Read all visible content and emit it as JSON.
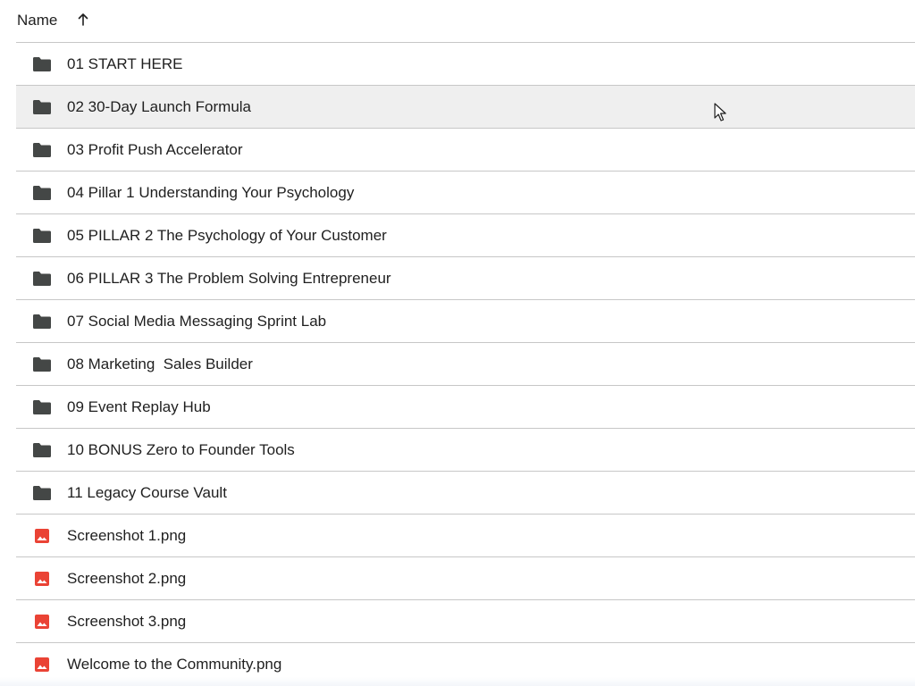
{
  "header": {
    "name_label": "Name",
    "sort_icon": "arrow-up-icon"
  },
  "rows": [
    {
      "label": "01 START HERE",
      "type": "folder",
      "icon": "folder-icon"
    },
    {
      "label": "02 30-Day Launch Formula",
      "type": "folder",
      "icon": "folder-icon",
      "hovered": true
    },
    {
      "label": "03 Profit Push Accelerator",
      "type": "folder",
      "icon": "folder-icon"
    },
    {
      "label": "04 Pillar 1 Understanding Your Psychology",
      "type": "folder",
      "icon": "folder-icon"
    },
    {
      "label": "05 PILLAR 2 The Psychology of Your Customer",
      "type": "folder",
      "icon": "folder-icon"
    },
    {
      "label": "06 PILLAR 3 The Problem Solving Entrepreneur",
      "type": "folder",
      "icon": "folder-icon"
    },
    {
      "label": "07 Social Media Messaging Sprint Lab",
      "type": "folder",
      "icon": "folder-icon"
    },
    {
      "label": "08 Marketing  Sales Builder",
      "type": "folder",
      "icon": "folder-icon"
    },
    {
      "label": "09 Event Replay Hub",
      "type": "folder",
      "icon": "folder-icon"
    },
    {
      "label": "10 BONUS Zero to Founder Tools",
      "type": "folder",
      "icon": "folder-icon"
    },
    {
      "label": "11 Legacy Course Vault",
      "type": "folder",
      "icon": "folder-icon"
    },
    {
      "label": "Screenshot 1.png",
      "type": "image",
      "icon": "image-file-icon"
    },
    {
      "label": "Screenshot 2.png",
      "type": "image",
      "icon": "image-file-icon"
    },
    {
      "label": "Screenshot 3.png",
      "type": "image",
      "icon": "image-file-icon"
    },
    {
      "label": "Welcome to the Community.png",
      "type": "image",
      "icon": "image-file-icon"
    }
  ],
  "colors": {
    "folder_icon": "#444746",
    "image_icon": "#ea4335",
    "row_hover": "#efefef",
    "divider": "#c7c7c7",
    "text": "#1f1f1f"
  }
}
